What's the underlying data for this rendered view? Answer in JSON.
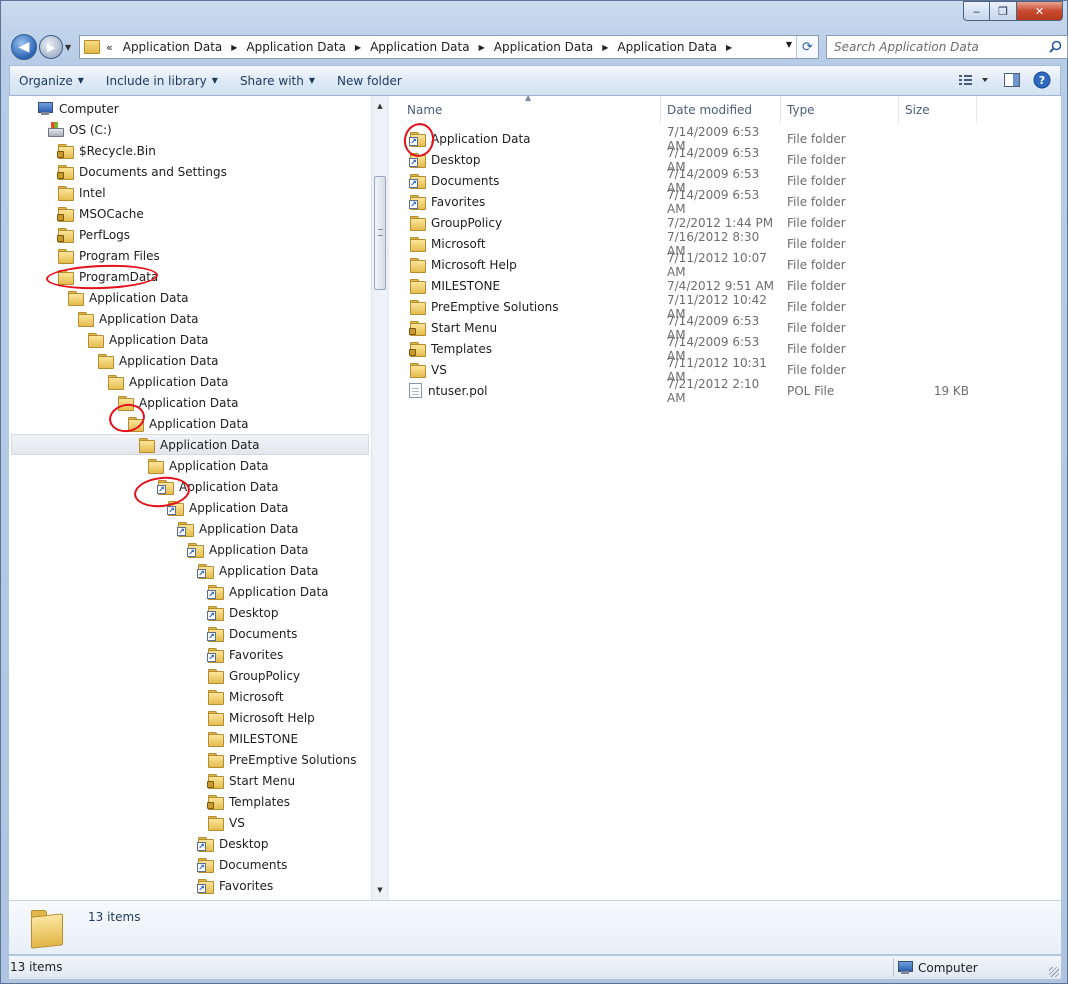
{
  "window": {
    "controls": {
      "minimize": "‒",
      "maximize": "❐",
      "close": "✕"
    }
  },
  "address": {
    "overflow": "«",
    "crumbs": [
      "Application Data",
      "Application Data",
      "Application Data",
      "Application Data",
      "Application Data"
    ],
    "search_placeholder": "Search Application Data"
  },
  "toolbar": {
    "organize": "Organize",
    "include_in_library": "Include in library",
    "share_with": "Share with",
    "new_folder": "New folder"
  },
  "nav_tree": [
    {
      "label": "Computer",
      "icon": "computer-icon",
      "indent": 0
    },
    {
      "label": "OS (C:)",
      "icon": "drive-icon",
      "indent": 1
    },
    {
      "label": "$Recycle.Bin",
      "icon": "folder-lock",
      "indent": 2
    },
    {
      "label": "Documents and Settings",
      "icon": "folder-lock",
      "indent": 2
    },
    {
      "label": "Intel",
      "icon": "folder",
      "indent": 2
    },
    {
      "label": "MSOCache",
      "icon": "folder-lock",
      "indent": 2
    },
    {
      "label": "PerfLogs",
      "icon": "folder-lock",
      "indent": 2
    },
    {
      "label": "Program Files",
      "icon": "folder",
      "indent": 2
    },
    {
      "label": "ProgramData",
      "icon": "folder",
      "indent": 2
    },
    {
      "label": "Application Data",
      "icon": "folder",
      "indent": 3
    },
    {
      "label": "Application Data",
      "icon": "folder",
      "indent": 4
    },
    {
      "label": "Application Data",
      "icon": "folder",
      "indent": 5
    },
    {
      "label": "Application Data",
      "icon": "folder",
      "indent": 6
    },
    {
      "label": "Application Data",
      "icon": "folder",
      "indent": 7
    },
    {
      "label": "Application Data",
      "icon": "folder",
      "indent": 8
    },
    {
      "label": "Application Data",
      "icon": "folder",
      "indent": 9
    },
    {
      "label": "Application Data",
      "icon": "folder",
      "indent": 10,
      "selected": true
    },
    {
      "label": "Application Data",
      "icon": "folder",
      "indent": 11
    },
    {
      "label": "Application Data",
      "icon": "folder-shortcut",
      "indent": 12
    },
    {
      "label": "Application Data",
      "icon": "folder-shortcut",
      "indent": 13
    },
    {
      "label": "Application Data",
      "icon": "folder-shortcut",
      "indent": 14
    },
    {
      "label": "Application Data",
      "icon": "folder-shortcut",
      "indent": 15
    },
    {
      "label": "Application Data",
      "icon": "folder-shortcut",
      "indent": 16
    },
    {
      "label": "Application Data",
      "icon": "folder-shortcut",
      "indent": 17
    },
    {
      "label": "Desktop",
      "icon": "folder-shortcut",
      "indent": 17
    },
    {
      "label": "Documents",
      "icon": "folder-shortcut",
      "indent": 17
    },
    {
      "label": "Favorites",
      "icon": "folder-shortcut",
      "indent": 17
    },
    {
      "label": "GroupPolicy",
      "icon": "folder",
      "indent": 17
    },
    {
      "label": "Microsoft",
      "icon": "folder",
      "indent": 17
    },
    {
      "label": "Microsoft Help",
      "icon": "folder",
      "indent": 17
    },
    {
      "label": "MILESTONE",
      "icon": "folder",
      "indent": 17
    },
    {
      "label": "PreEmptive Solutions",
      "icon": "folder",
      "indent": 17
    },
    {
      "label": "Start Menu",
      "icon": "folder-lock",
      "indent": 17
    },
    {
      "label": "Templates",
      "icon": "folder-lock",
      "indent": 17
    },
    {
      "label": "VS",
      "icon": "folder",
      "indent": 17
    },
    {
      "label": "Desktop",
      "icon": "folder-shortcut",
      "indent": 16
    },
    {
      "label": "Documents",
      "icon": "folder-shortcut",
      "indent": 16
    },
    {
      "label": "Favorites",
      "icon": "folder-shortcut",
      "indent": 16
    }
  ],
  "columns": [
    "Name",
    "Date modified",
    "Type",
    "Size"
  ],
  "files": [
    {
      "name": "Application Data",
      "date": "7/14/2009 6:53 AM",
      "type": "File folder",
      "size": "",
      "icon": "folder-shortcut"
    },
    {
      "name": "Desktop",
      "date": "7/14/2009 6:53 AM",
      "type": "File folder",
      "size": "",
      "icon": "folder-shortcut"
    },
    {
      "name": "Documents",
      "date": "7/14/2009 6:53 AM",
      "type": "File folder",
      "size": "",
      "icon": "folder-shortcut"
    },
    {
      "name": "Favorites",
      "date": "7/14/2009 6:53 AM",
      "type": "File folder",
      "size": "",
      "icon": "folder-shortcut"
    },
    {
      "name": "GroupPolicy",
      "date": "7/2/2012 1:44 PM",
      "type": "File folder",
      "size": "",
      "icon": "folder"
    },
    {
      "name": "Microsoft",
      "date": "7/16/2012 8:30 AM",
      "type": "File folder",
      "size": "",
      "icon": "folder"
    },
    {
      "name": "Microsoft Help",
      "date": "7/11/2012 10:07 AM",
      "type": "File folder",
      "size": "",
      "icon": "folder"
    },
    {
      "name": "MILESTONE",
      "date": "7/4/2012 9:51 AM",
      "type": "File folder",
      "size": "",
      "icon": "folder"
    },
    {
      "name": "PreEmptive Solutions",
      "date": "7/11/2012 10:42 AM",
      "type": "File folder",
      "size": "",
      "icon": "folder"
    },
    {
      "name": "Start Menu",
      "date": "7/14/2009 6:53 AM",
      "type": "File folder",
      "size": "",
      "icon": "folder-lock"
    },
    {
      "name": "Templates",
      "date": "7/14/2009 6:53 AM",
      "type": "File folder",
      "size": "",
      "icon": "folder-lock"
    },
    {
      "name": "VS",
      "date": "7/11/2012 10:31 AM",
      "type": "File folder",
      "size": "",
      "icon": "folder"
    },
    {
      "name": "ntuser.pol",
      "date": "7/21/2012 2:10 AM",
      "type": "POL File",
      "size": "19 KB",
      "icon": "file"
    }
  ],
  "details_pane": {
    "count": "13 items"
  },
  "status": {
    "left": "13 items",
    "right": "Computer"
  },
  "colors": {
    "annotation": "#e3101a",
    "selection": "#e3e7ed",
    "toolbar_text": "#1e395b"
  }
}
